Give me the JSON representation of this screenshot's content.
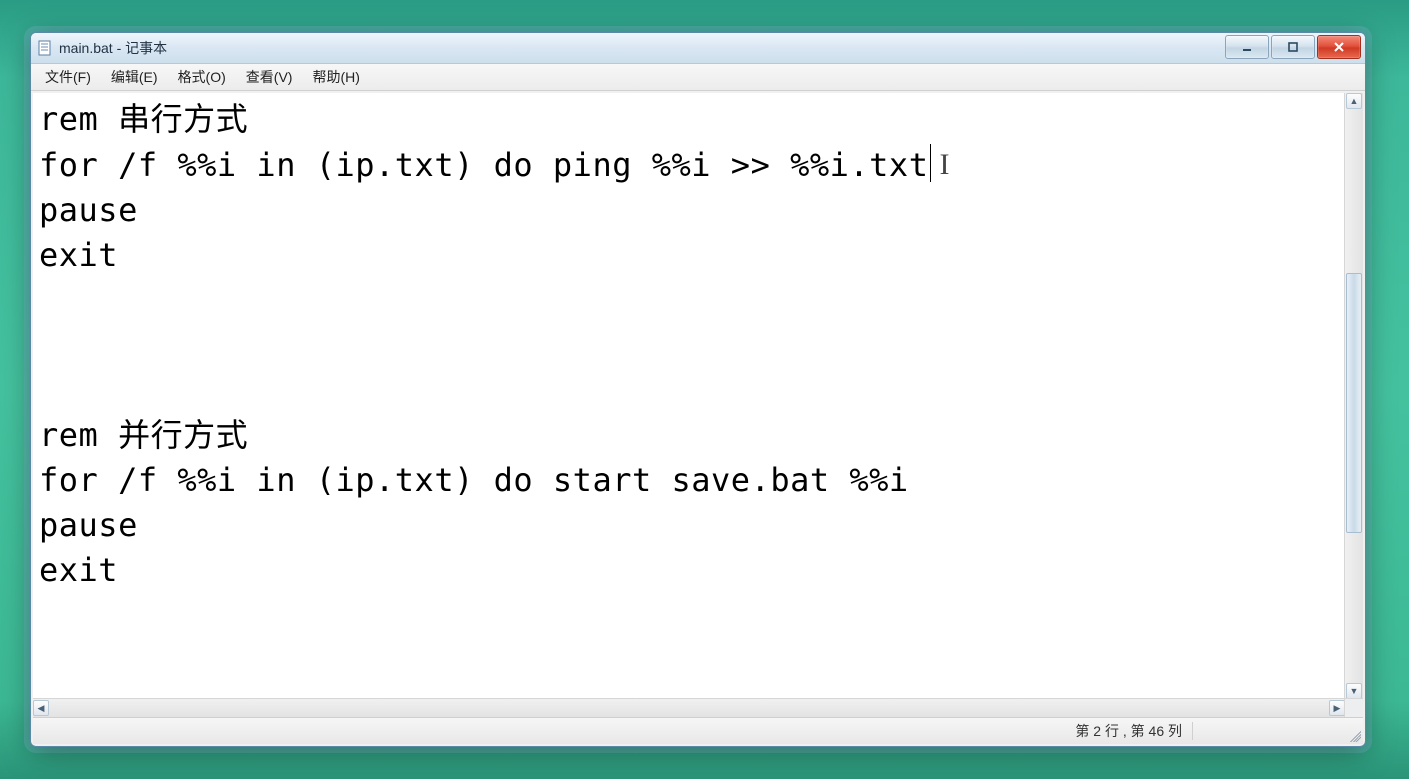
{
  "window": {
    "title": "main.bat - 记事本"
  },
  "menubar": {
    "items": [
      {
        "label": "文件(F)"
      },
      {
        "label": "编辑(E)"
      },
      {
        "label": "格式(O)"
      },
      {
        "label": "查看(V)"
      },
      {
        "label": "帮助(H)"
      }
    ]
  },
  "editor": {
    "lines": [
      "rem 串行方式",
      "for /f %%i in (ip.txt) do ping %%i >> %%i.txt",
      "pause",
      "exit",
      "",
      "",
      "",
      "rem 并行方式",
      "for /f %%i in (ip.txt) do start save.bat %%i",
      "pause",
      "exit"
    ],
    "cursor_line_index": 1
  },
  "statusbar": {
    "text": "第 2 行 , 第 46 列"
  }
}
